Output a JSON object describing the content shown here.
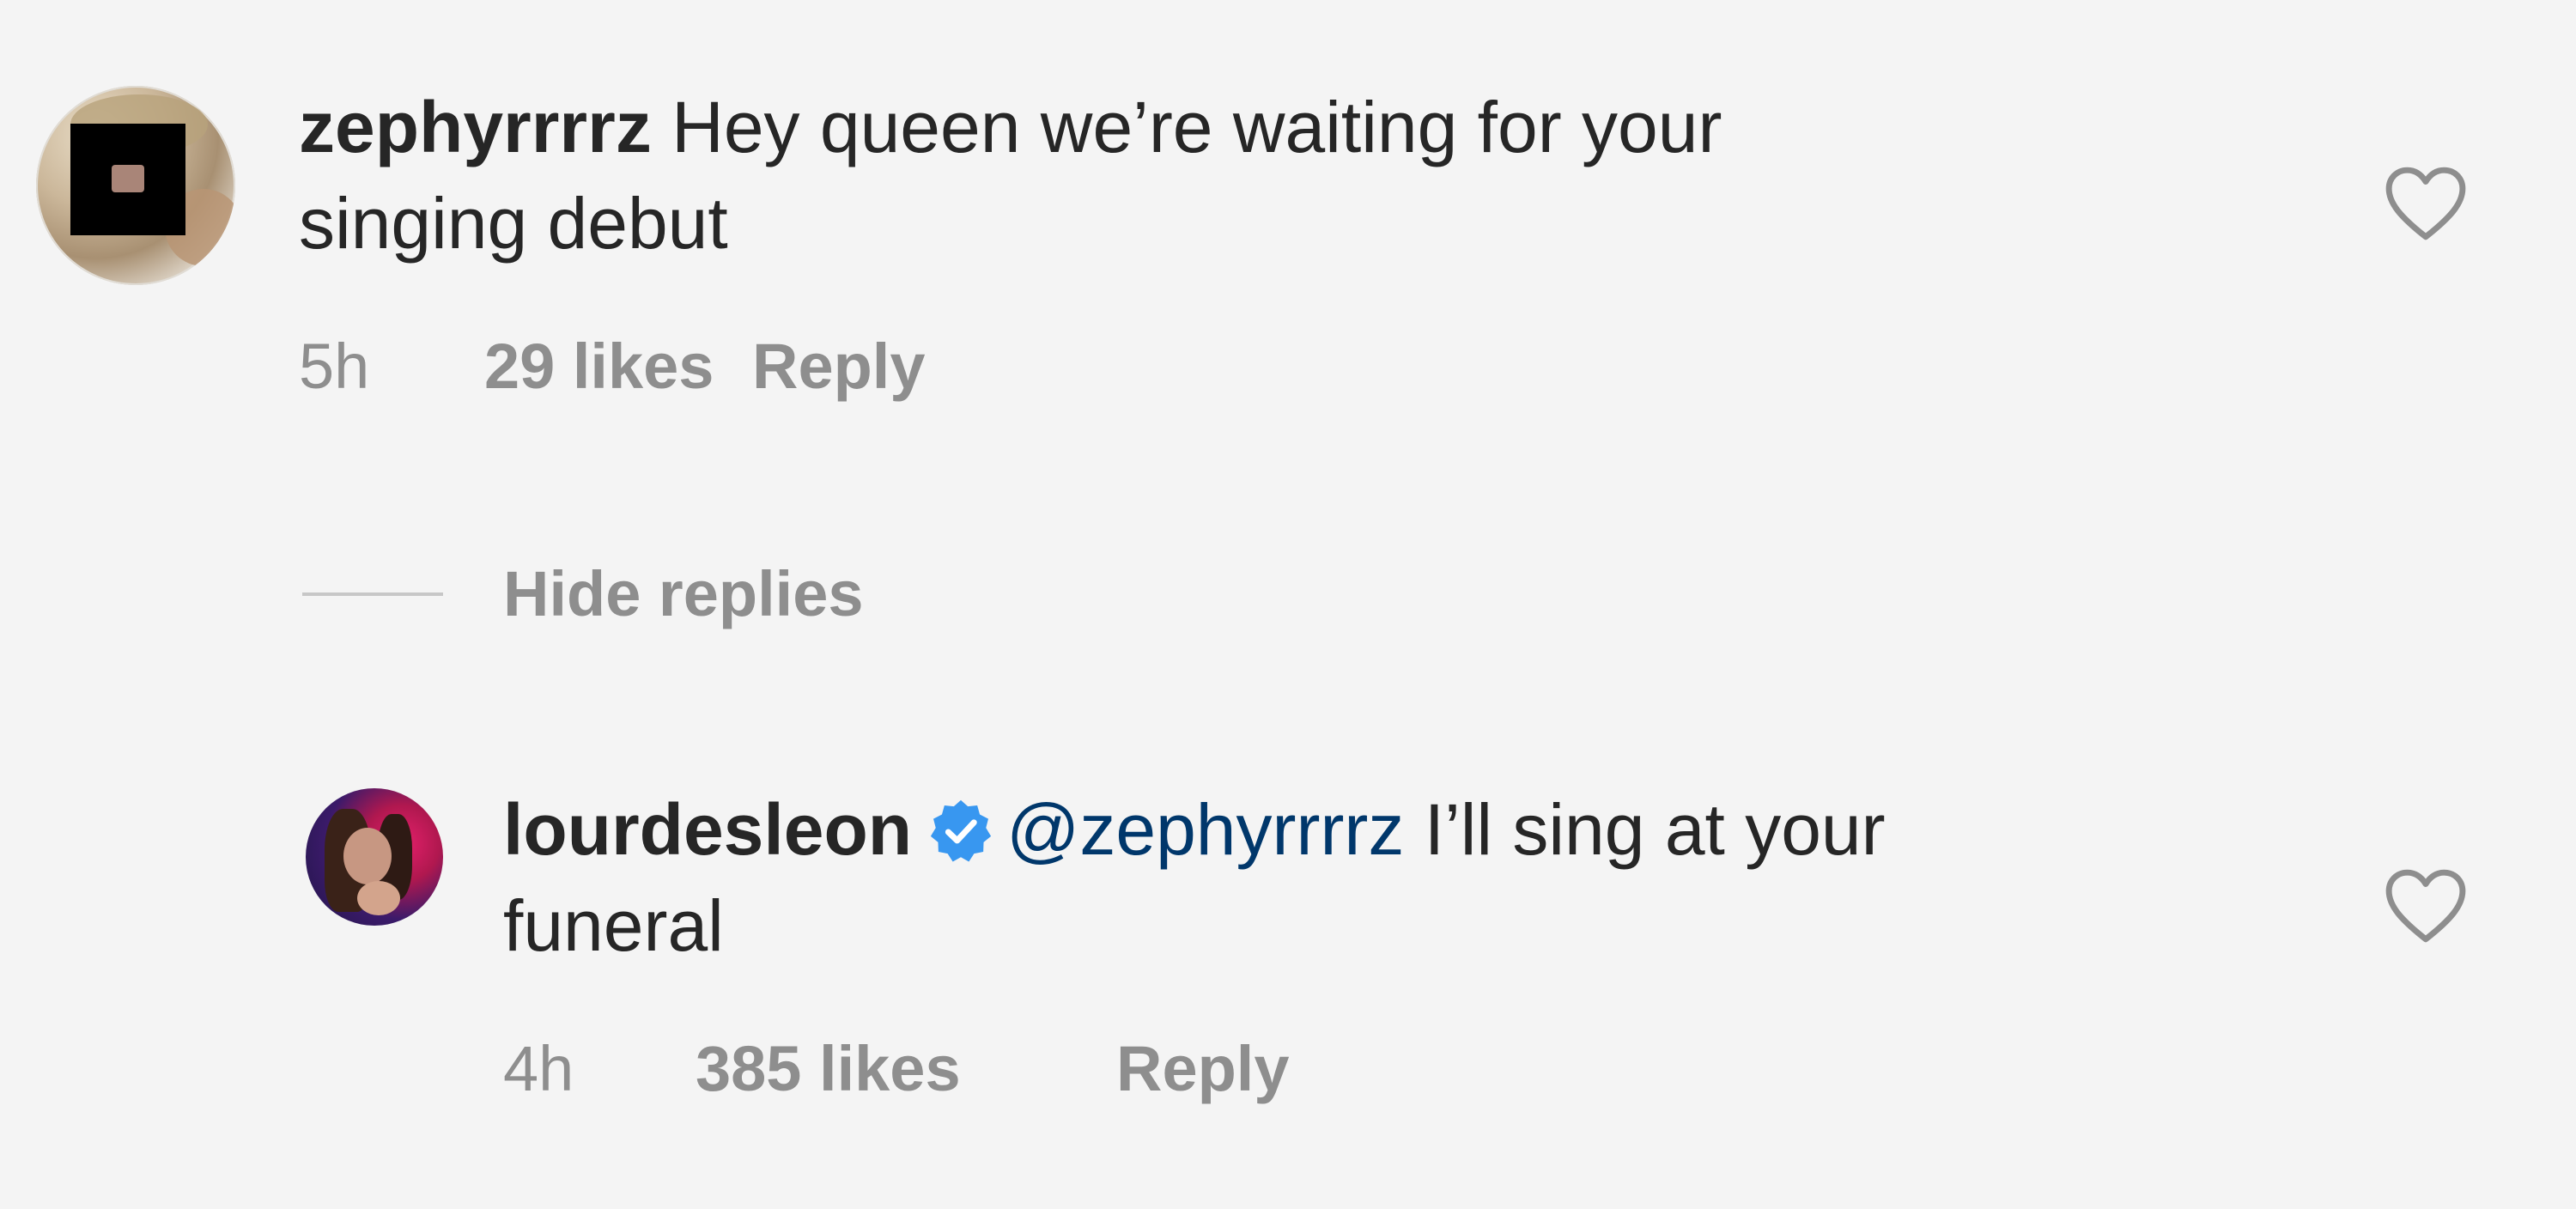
{
  "comments": [
    {
      "username": "zephyrrrrz",
      "text_line1": " Hey queen we’re waiting for your",
      "text_line2": "singing debut",
      "time": "5h",
      "likes": "29 likes",
      "reply_label": "Reply",
      "icons": {
        "like": "heart-outline-icon",
        "avatar": "user-avatar"
      }
    },
    {
      "username": "lourdesleon",
      "verified": true,
      "mention": "@zephyrrrrz",
      "text_line1": " I’ll sing at your",
      "text_line2": "funeral",
      "time": "4h",
      "likes": "385 likes",
      "reply_label": "Reply",
      "icons": {
        "like": "heart-outline-icon",
        "verified": "verified-badge-icon",
        "avatar": "user-avatar"
      }
    }
  ],
  "thread": {
    "hide_replies_label": "Hide replies"
  },
  "colors": {
    "background": "#f4f4f4",
    "text": "#262626",
    "secondary_text": "#8e8e8e",
    "mention": "#00376b",
    "verified": "#3897f0"
  }
}
